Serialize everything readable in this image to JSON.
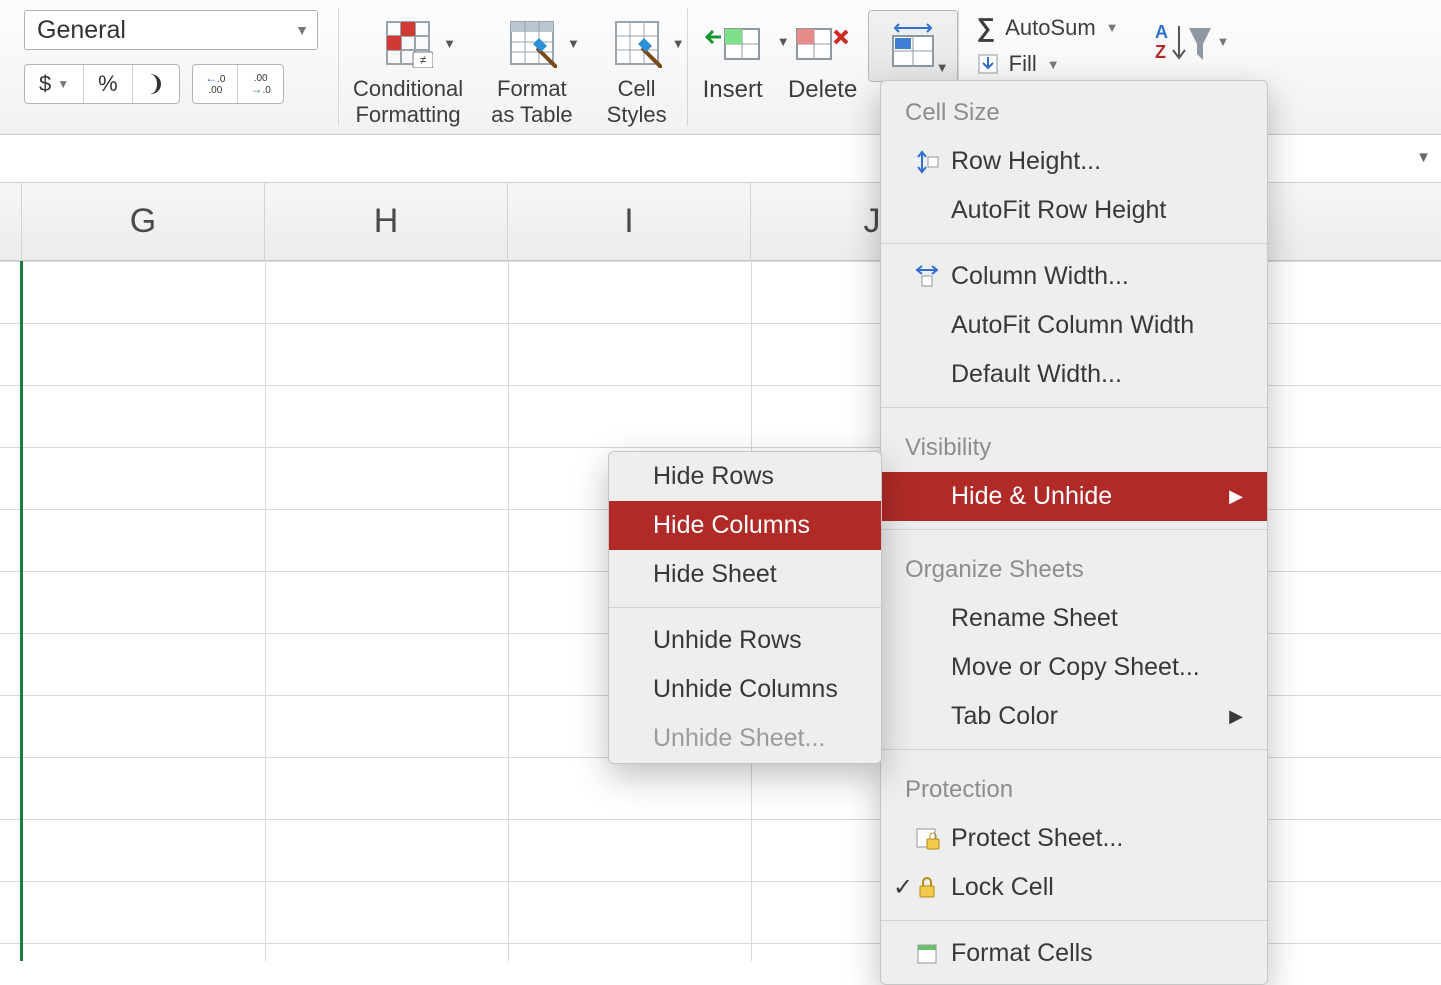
{
  "ribbon": {
    "number_format": "General",
    "currency_symbol": "$",
    "percent_symbol": "%",
    "comma_symbol": "❩",
    "conditional_label_l1": "Conditional",
    "conditional_label_l2": "Formatting",
    "format_table_l1": "Format",
    "format_table_l2": "as Table",
    "cell_styles_l1": "Cell",
    "cell_styles_l2": "Styles",
    "insert_label": "Insert",
    "delete_label": "Delete",
    "autosum_label": "AutoSum",
    "fill_label": "Fill"
  },
  "columns": [
    "G",
    "H",
    "I",
    "J"
  ],
  "format_menu": {
    "sections": {
      "cell_size": "Cell Size",
      "visibility": "Visibility",
      "organize": "Organize Sheets",
      "protection": "Protection"
    },
    "row_height": "Row Height...",
    "autofit_row": "AutoFit Row Height",
    "col_width": "Column Width...",
    "autofit_col": "AutoFit Column Width",
    "default_width": "Default Width...",
    "hide_unhide": "Hide & Unhide",
    "rename_sheet": "Rename Sheet",
    "move_copy": "Move or Copy Sheet...",
    "tab_color": "Tab Color",
    "protect_sheet": "Protect Sheet...",
    "lock_cell": "Lock Cell",
    "format_cells": "Format Cells"
  },
  "hide_menu": {
    "hide_rows": "Hide Rows",
    "hide_columns": "Hide Columns",
    "hide_sheet": "Hide Sheet",
    "unhide_rows": "Unhide Rows",
    "unhide_columns": "Unhide Columns",
    "unhide_sheet": "Unhide Sheet..."
  }
}
